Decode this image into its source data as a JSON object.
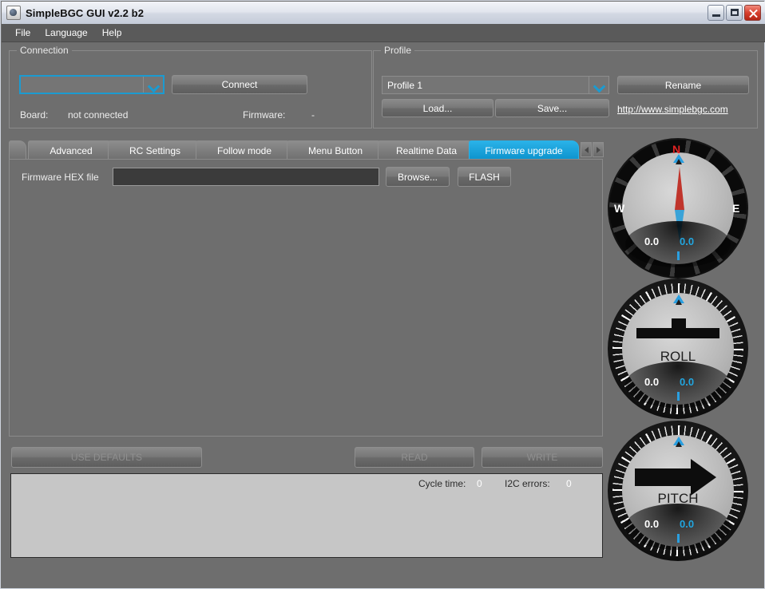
{
  "window": {
    "title": "SimpleBGC GUI v2.2 b2",
    "icon": "java-coffee-cup-icon",
    "buttons": {
      "minimize": "minimize",
      "maximize": "maximize",
      "close": "close"
    }
  },
  "menubar": {
    "items": [
      "File",
      "Language",
      "Help"
    ]
  },
  "connection": {
    "group_title": "Connection",
    "port_value": "",
    "connect_label": "Connect",
    "board_label": "Board:",
    "board_value": "not connected",
    "firmware_label": "Firmware:",
    "firmware_value": "-"
  },
  "profile": {
    "group_title": "Profile",
    "selected": "Profile 1",
    "rename_label": "Rename",
    "load_label": "Load...",
    "save_label": "Save...",
    "site_link": "http://www.simplebgc.com"
  },
  "tabs": [
    {
      "label": "Advanced",
      "active": false
    },
    {
      "label": "RC Settings",
      "active": false
    },
    {
      "label": "Follow mode",
      "active": false
    },
    {
      "label": "Menu Button",
      "active": false
    },
    {
      "label": "Realtime Data",
      "active": false
    },
    {
      "label": "Firmware upgrade",
      "active": true
    }
  ],
  "firmware_tab": {
    "hex_label": "Firmware HEX file",
    "hex_value": "",
    "browse_label": "Browse...",
    "flash_label": "FLASH"
  },
  "actions": {
    "use_defaults": "USE DEFAULTS",
    "read": "READ",
    "write": "WRITE"
  },
  "status": {
    "cycle_time_label": "Cycle time:",
    "cycle_time_value": "0",
    "i2c_errors_label": "I2C errors:",
    "i2c_errors_value": "0"
  },
  "gauges": [
    {
      "name": "compass",
      "label": "",
      "north": "N",
      "west": "W",
      "east": "E",
      "actual": "0.0",
      "target": "0.0"
    },
    {
      "name": "roll",
      "label": "ROLL",
      "actual": "0.0",
      "target": "0.0"
    },
    {
      "name": "pitch",
      "label": "PITCH",
      "actual": "0.0",
      "target": "0.0"
    }
  ],
  "colors": {
    "accent": "#1b9bd1",
    "active_tab": "#17a0da",
    "needle_red": "#c0352c",
    "needle_blue": "#3aa3d8",
    "panel_bg": "#6e6e6e",
    "status_bg": "#c6c6c6"
  }
}
